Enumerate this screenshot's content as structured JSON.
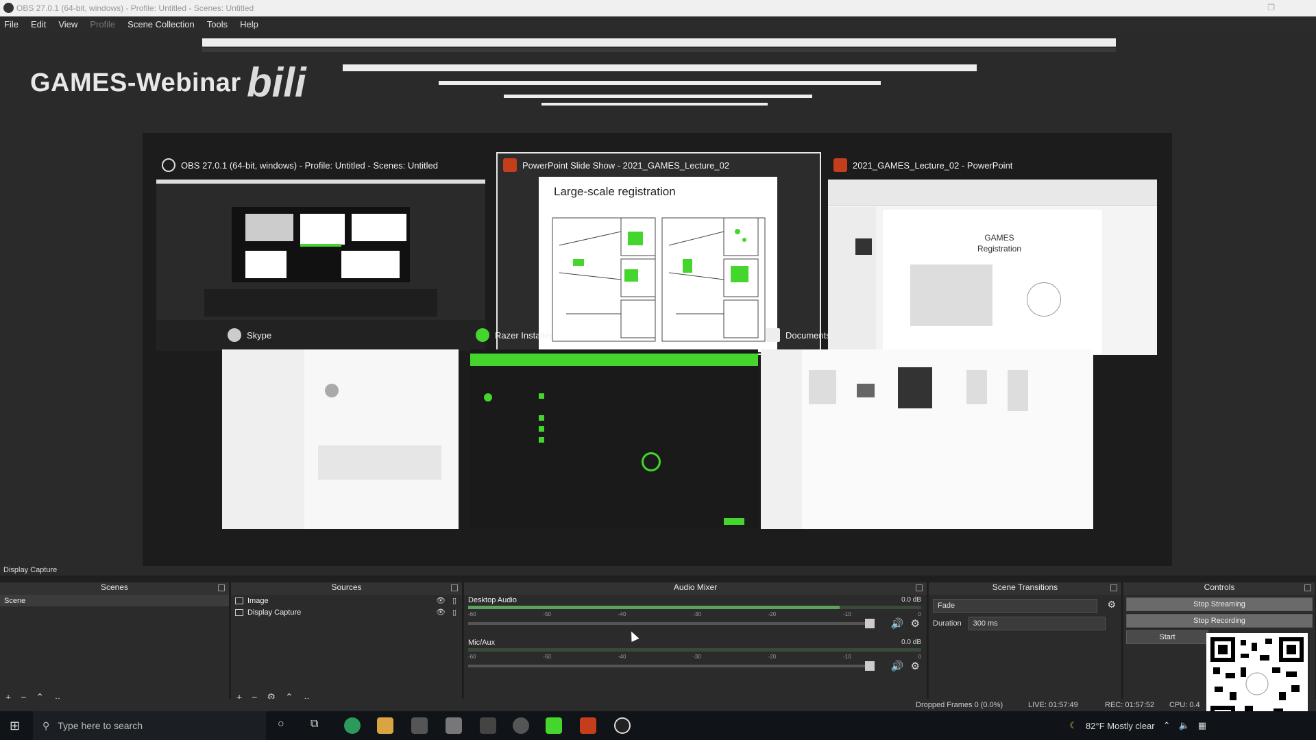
{
  "window": {
    "title": "OBS 27.0.1 (64-bit, windows) - Profile: Untitled - Scenes: Untitled"
  },
  "menu": [
    "File",
    "Edit",
    "View",
    "Profile",
    "Scene Collection",
    "Tools",
    "Help"
  ],
  "watermark": {
    "text": "GAMES-Webinar"
  },
  "switcher": {
    "cards": [
      {
        "title": "OBS 27.0.1 (64-bit, windows) - Profile: Untitled - Scenes: Untitled",
        "icon": "obs-icon"
      },
      {
        "title": "PowerPoint Slide Show  -  2021_GAMES_Lecture_02",
        "icon": "powerpoint-icon",
        "slide_title": "Large-scale registration"
      },
      {
        "title": "2021_GAMES_Lecture_02 - PowerPoint",
        "icon": "powerpoint-icon",
        "slide_line1": "GAMES",
        "slide_line2": "Registration"
      },
      {
        "title": "Skype",
        "icon": "skype-icon"
      },
      {
        "title": "Razer Installer",
        "icon": "razer-icon"
      },
      {
        "title": "Documents",
        "icon": "folder-icon"
      }
    ]
  },
  "preview_label": "Display Capture",
  "scenes": {
    "header": "Scenes",
    "items": [
      "Scene"
    ]
  },
  "sources": {
    "header": "Sources",
    "items": [
      "Image",
      "Display Capture"
    ]
  },
  "mixer": {
    "header": "Audio Mixer",
    "tracks": [
      {
        "name": "Desktop Audio",
        "db": "0.0 dB",
        "level": 0.82
      },
      {
        "name": "Mic/Aux",
        "db": "0.0 dB",
        "level": 0.0
      }
    ]
  },
  "transitions": {
    "header": "Scene Transitions",
    "selected": "Fade",
    "duration_label": "Duration",
    "duration_value": "300 ms"
  },
  "controls": {
    "header": "Controls",
    "buttons": [
      "Stop Streaming",
      "Stop Recording",
      "Start"
    ]
  },
  "status": {
    "dropped": "Dropped Frames 0 (0.0%)",
    "live": "LIVE: 01:57:49",
    "rec": "REC: 01:57:52",
    "cpu": "CPU: 0.4"
  },
  "taskbar": {
    "search_placeholder": "Type here to search",
    "weather": "82°F  Mostly clear"
  },
  "colors": {
    "accent_green": "#44d62c",
    "obs_dark": "#2b2b2b"
  }
}
